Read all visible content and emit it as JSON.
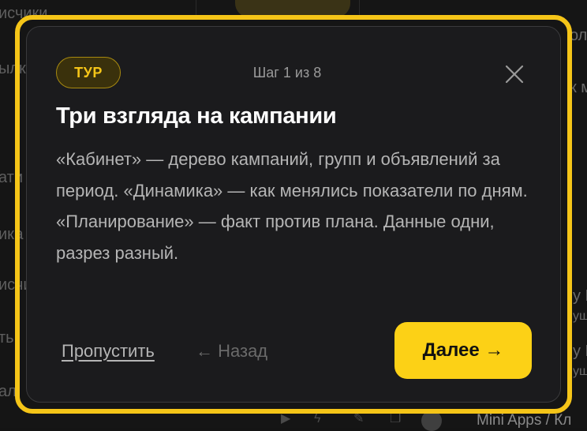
{
  "background": {
    "left_fragments": [
      "исчики",
      "ылк",
      "ати",
      "ика",
      "исчи",
      "ть",
      "ал"
    ],
    "right_fragments": [
      "оле",
      "к ме",
      "у Кл",
      "уш",
      "у Кл",
      "уш"
    ],
    "footer_text": "Mini Apps / Кл",
    "footer_icons": [
      "play-icon",
      "bolt-icon",
      "pencil-icon",
      "copy-icon"
    ]
  },
  "tour": {
    "badge": "ТУР",
    "step": "Шаг 1 из 8",
    "title": "Три взгляда на кампании",
    "body": "«Кабинет» — дерево кампаний, групп и объявлений за период. «Динамика» — как менялись показатели по дням. «Планирование» — факт против плана. Данные одни, разрез разный.",
    "skip_label": "Пропустить",
    "back_label": "← Назад",
    "next_label": "Далее →",
    "close_icon": "close-icon"
  },
  "colors": {
    "accent": "#f5c518",
    "button": "#fcd116",
    "dialog_bg": "#1b1b1d"
  }
}
